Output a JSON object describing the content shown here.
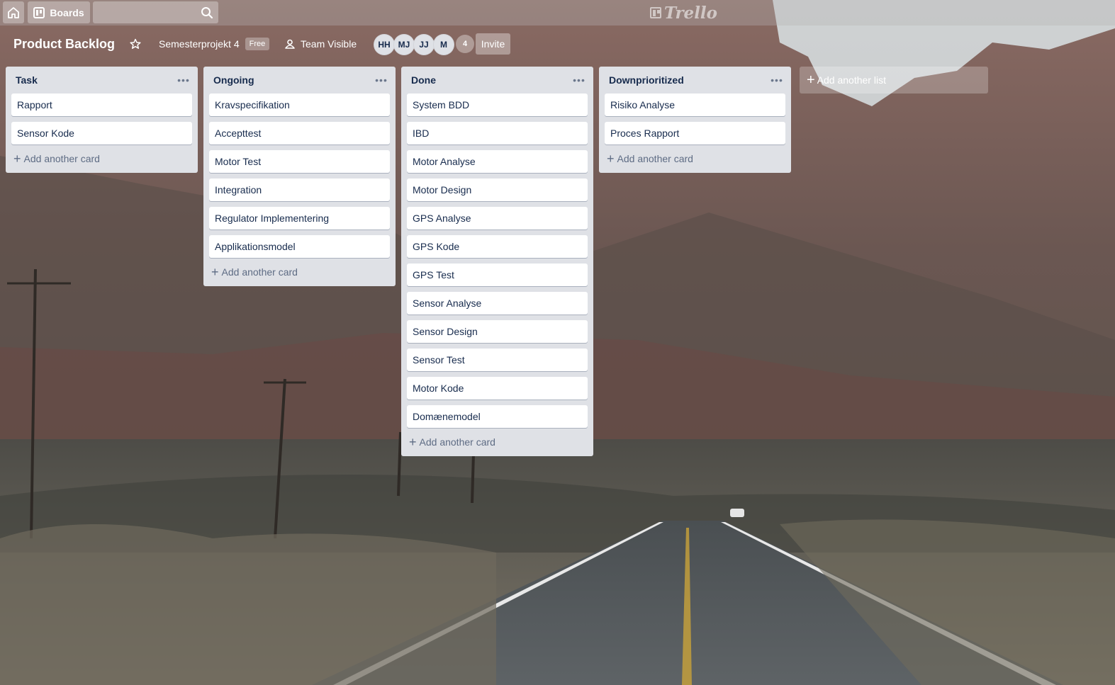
{
  "topbar": {
    "boards_label": "Boards",
    "search_value": "",
    "logo_text": "Trello"
  },
  "board": {
    "title": "Product Backlog",
    "team_name": "Semesterprojekt 4",
    "team_badge": "Free",
    "visibility": "Team Visible",
    "members": [
      "HH",
      "MJ",
      "JJ",
      "M"
    ],
    "member_count": "4",
    "invite_label": "Invite"
  },
  "lists": [
    {
      "title": "Task",
      "cards": [
        "Rapport",
        "Sensor Kode"
      ],
      "add_card_label": "Add another card"
    },
    {
      "title": "Ongoing",
      "cards": [
        "Kravspecifikation",
        "Accepttest",
        "Motor Test",
        "Integration",
        "Regulator Implementering",
        "Applikationsmodel"
      ],
      "add_card_label": "Add another card"
    },
    {
      "title": "Done",
      "cards": [
        "System BDD",
        "IBD",
        "Motor Analyse",
        "Motor Design",
        "GPS Analyse",
        "GPS Kode",
        "GPS Test",
        "Sensor Analyse",
        "Sensor Design",
        "Sensor Test",
        "Motor Kode",
        "Domænemodel"
      ],
      "add_card_label": "Add another card"
    },
    {
      "title": "Downprioritized",
      "cards": [
        "Risiko Analyse",
        "Proces Rapport"
      ],
      "add_card_label": "Add another card"
    }
  ],
  "add_list_label": "Add another list",
  "icons": [
    "home-icon",
    "boards-icon",
    "search-icon",
    "star-icon",
    "team-icon",
    "list-menu-icon",
    "plus-icon"
  ],
  "colors": {
    "list_bg": "#dfe1e6",
    "card_bg": "#ffffff",
    "text": "#172b4d",
    "muted": "#5e6c84"
  }
}
